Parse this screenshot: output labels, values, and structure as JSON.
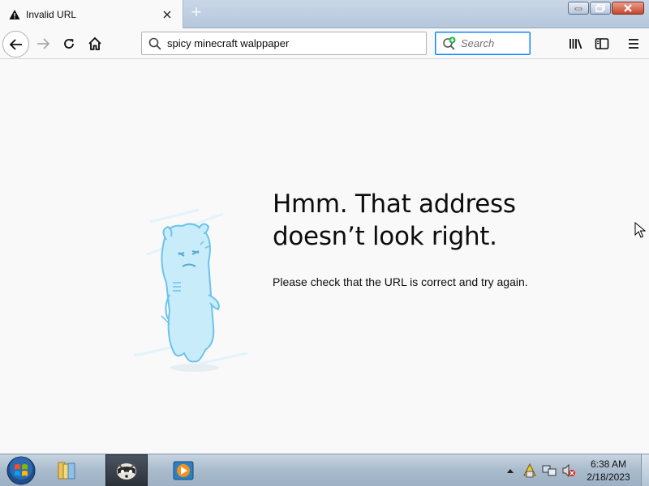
{
  "tab": {
    "title": "Invalid URL",
    "close_glyph": "✕",
    "icon": "warning-icon"
  },
  "newtab": {
    "glyph": "+"
  },
  "nav": {
    "url_value": "spicy minecraft walppaper",
    "search_placeholder": "Search"
  },
  "error": {
    "title_line1": "Hmm. That address",
    "title_line2": "doesn’t look right.",
    "description": "Please check that the URL is correct and try again."
  },
  "taskbar": {
    "time": "6:38 AM",
    "date": "2/18/2023"
  },
  "colors": {
    "accent": "#0a84ff",
    "illustration": "#a8dcf5"
  }
}
